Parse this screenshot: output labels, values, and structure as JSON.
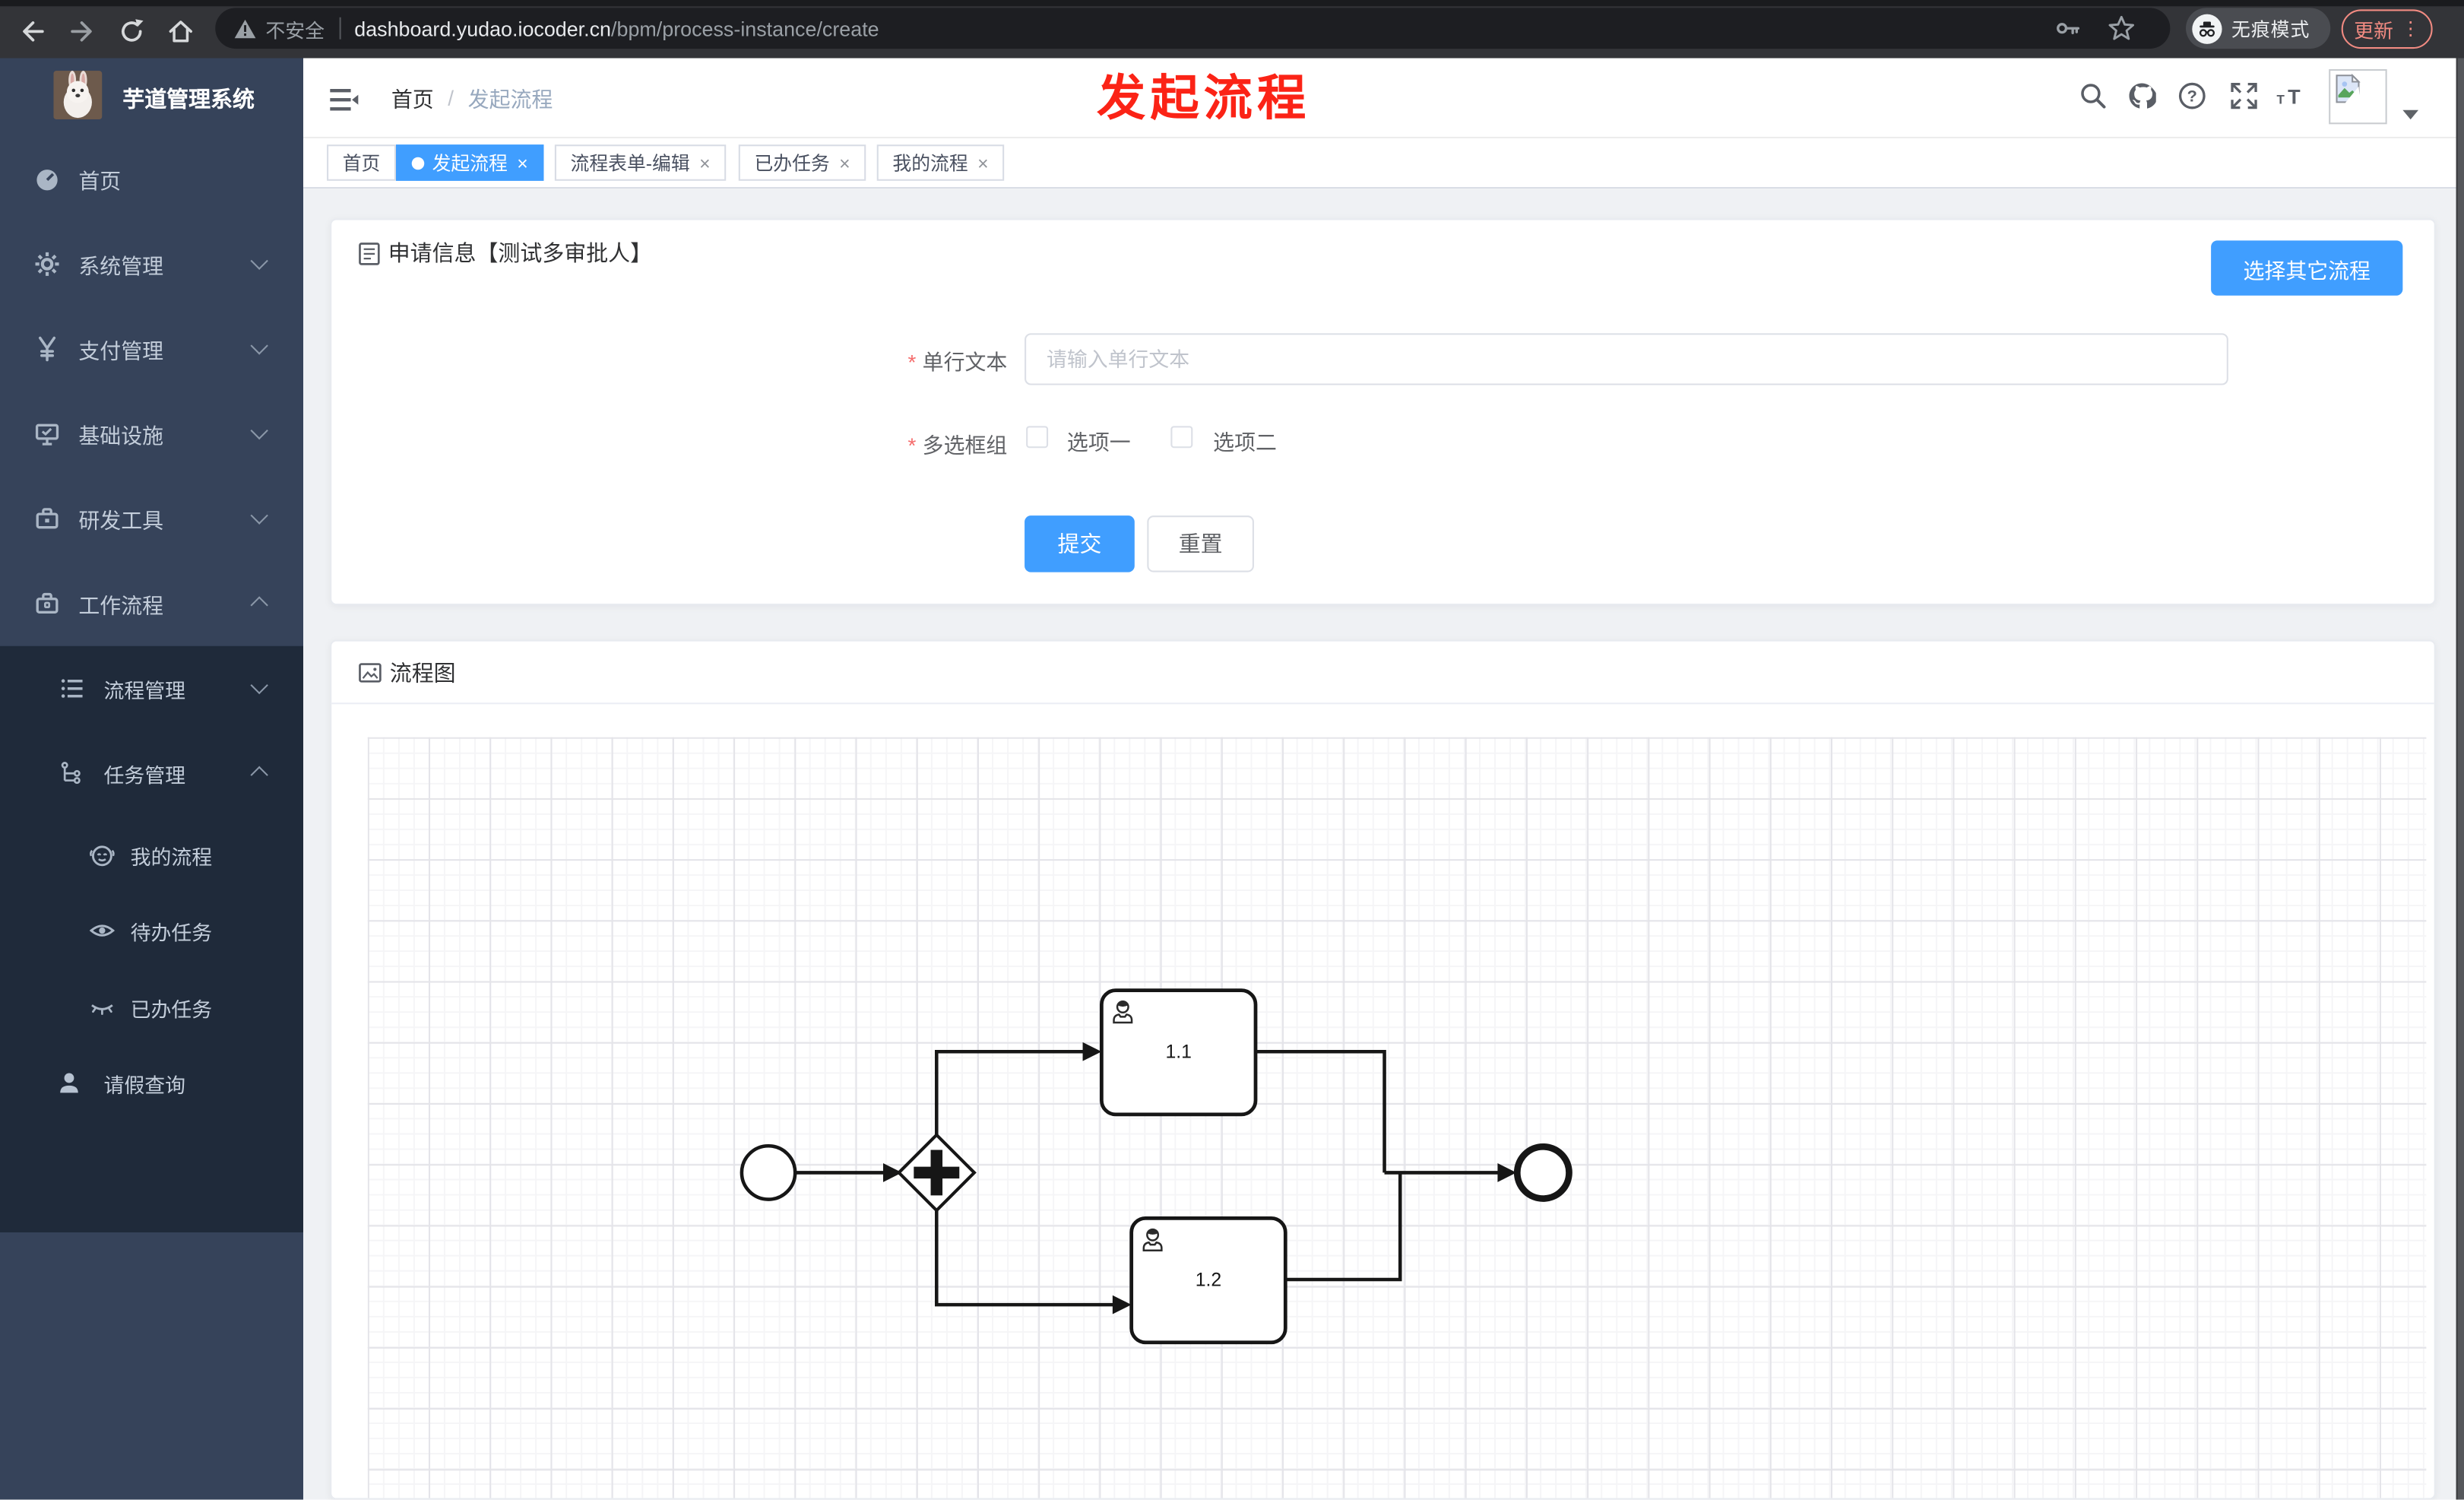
{
  "browser": {
    "security_label": "不安全",
    "url_domain": "dashboard.yudao.iocoder.cn",
    "url_path": "/bpm/process-instance/create",
    "incognito_label": "无痕模式",
    "update_label": "更新",
    "menu_dots": "⋮"
  },
  "annotation": {
    "text": "发起流程",
    "color": "#fb2316"
  },
  "sidebar": {
    "title": "芋道管理系统",
    "top_items": [
      {
        "label": "首页",
        "icon": "dashboard-icon",
        "chevron": ""
      },
      {
        "label": "系统管理",
        "icon": "gear-icon",
        "chevron": "down"
      },
      {
        "label": "支付管理",
        "icon": "yen-icon",
        "chevron": "down"
      },
      {
        "label": "基础设施",
        "icon": "monitor-icon",
        "chevron": "down"
      },
      {
        "label": "研发工具",
        "icon": "toolbox-icon",
        "chevron": "down"
      },
      {
        "label": "工作流程",
        "icon": "briefcase-icon",
        "chevron": "up",
        "expanded": true
      }
    ],
    "sub_items": [
      {
        "label": "流程管理",
        "icon": "flow-list-icon",
        "chevron": "down",
        "level": 1
      },
      {
        "label": "任务管理",
        "icon": "org-tree-icon",
        "chevron": "up",
        "level": 1,
        "expanded": true
      },
      {
        "label": "我的流程",
        "icon": "robot-face-icon",
        "chevron": "",
        "level": 2
      },
      {
        "label": "待办任务",
        "icon": "eye-open-icon",
        "chevron": "",
        "level": 2
      },
      {
        "label": "已办任务",
        "icon": "eye-closed-icon",
        "chevron": "",
        "level": 2
      },
      {
        "label": "请假查询",
        "icon": "user-icon",
        "chevron": "",
        "level": 1
      }
    ]
  },
  "header": {
    "breadcrumb_home": "首页",
    "breadcrumb_sep": "/",
    "breadcrumb_current": "发起流程",
    "icons": {
      "help_glyph": "?",
      "font_small": "T",
      "font_big": "T"
    }
  },
  "tabs": {
    "close_glyph": "×",
    "items": [
      {
        "label": "首页",
        "active": false,
        "closable": false
      },
      {
        "label": "发起流程",
        "active": true,
        "closable": true
      },
      {
        "label": "流程表单-编辑",
        "active": false,
        "closable": true
      },
      {
        "label": "已办任务",
        "active": false,
        "closable": true
      },
      {
        "label": "我的流程",
        "active": false,
        "closable": true
      }
    ]
  },
  "form_card": {
    "title": "申请信息【测试多审批人】",
    "choose_other_button": "选择其它流程",
    "required_mark": "*",
    "text_field": {
      "label": "单行文本",
      "required": true,
      "placeholder": "请输入单行文本",
      "value": ""
    },
    "checkbox_group": {
      "label": "多选框组",
      "required": true,
      "options": [
        {
          "label": "选项一",
          "checked": false
        },
        {
          "label": "选项二",
          "checked": false
        }
      ]
    },
    "submit_label": "提交",
    "reset_label": "重置"
  },
  "diagram_card": {
    "title": "流程图",
    "bpmn": {
      "start": "start-event",
      "gateway": "parallel-gateway",
      "tasks": [
        {
          "label": "1.1",
          "type": "user-task"
        },
        {
          "label": "1.2",
          "type": "user-task"
        }
      ],
      "end": "end-event"
    }
  },
  "colors": {
    "accent": "#409eff",
    "sidebar_bg": "#36435a",
    "submenu_bg": "#1f2a3a",
    "update_pill": "#f28b82",
    "annotation_red": "#fb2316"
  }
}
